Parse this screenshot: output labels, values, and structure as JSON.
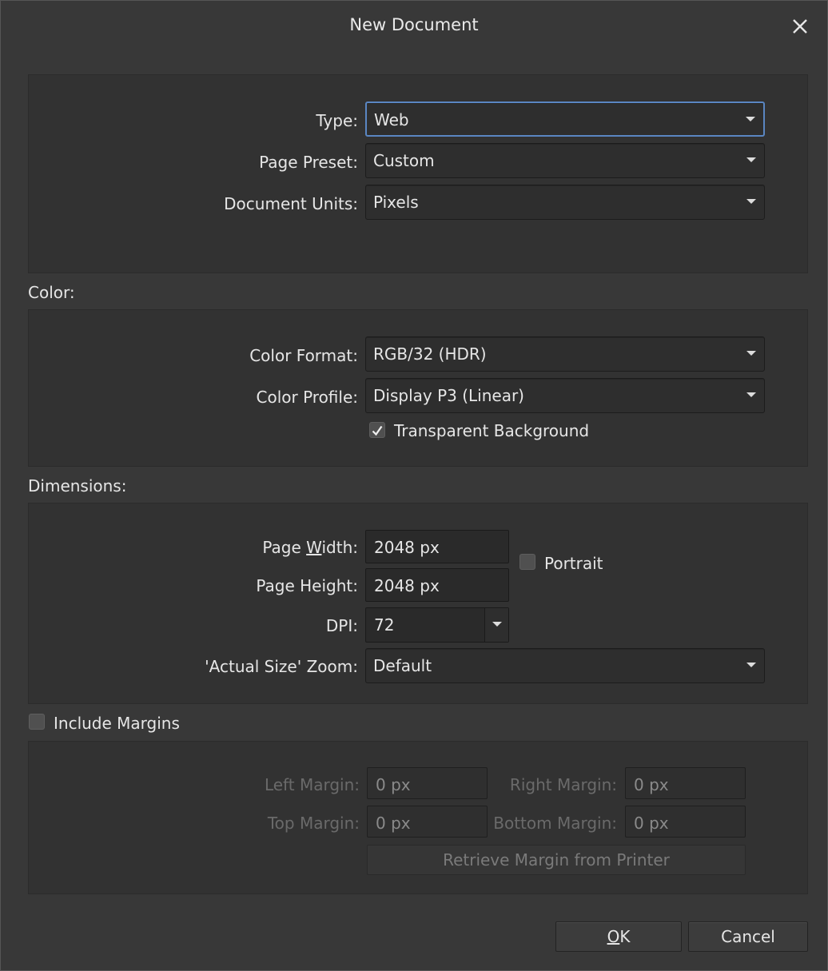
{
  "dialog": {
    "title": "New Document",
    "close_icon": "close-icon"
  },
  "general": {
    "type_label": "Type:",
    "type_value": "Web",
    "preset_label": "Page Preset:",
    "preset_value": "Custom",
    "units_label": "Document Units:",
    "units_value": "Pixels"
  },
  "color": {
    "section_label": "Color:",
    "format_label": "Color Format:",
    "format_value": "RGB/32 (HDR)",
    "profile_label": "Color Profile:",
    "profile_value": "Display P3 (Linear)",
    "transparent_label": "Transparent Background",
    "transparent_checked": true
  },
  "dimensions": {
    "section_label": "Dimensions:",
    "width_label_pre": "Page ",
    "width_label_mnemonic": "W",
    "width_label_post": "idth:",
    "width_value": "2048 px",
    "height_label": "Page Height:",
    "height_value": "2048 px",
    "portrait_label": "Portrait",
    "portrait_checked": false,
    "dpi_label": "DPI:",
    "dpi_value": "72",
    "zoom_label": "'Actual Size' Zoom:",
    "zoom_value": "Default"
  },
  "margins": {
    "include_label": "Include Margins",
    "include_checked": false,
    "left_label": "Left Margin:",
    "left_value": "0 px",
    "right_label": "Right Margin:",
    "right_value": "0 px",
    "top_label": "Top Margin:",
    "top_value": "0 px",
    "bottom_label": "Bottom Margin:",
    "bottom_value": "0 px",
    "retrieve_label": "Retrieve Margin from Printer"
  },
  "footer": {
    "ok_label": "OK",
    "cancel_label": "Cancel"
  },
  "colors": {
    "background": "#383838",
    "panel": "#323232",
    "focus": "#5a86c2"
  }
}
